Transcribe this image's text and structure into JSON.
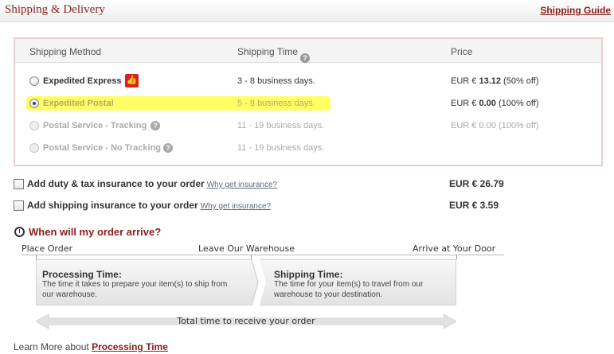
{
  "header": {
    "title": "Shipping & Delivery",
    "guide_link": "Shipping Guide"
  },
  "shipping_table": {
    "columns": [
      "Shipping Method",
      "Shipping Time",
      "Price"
    ],
    "rows": [
      {
        "name": "Expedited Express",
        "time": "3 - 8 business days.",
        "price_prefix": "EUR € ",
        "price_value": "13.12",
        "price_note": " (50% off)",
        "selected": false,
        "disabled": false,
        "badge": "thumbs-up-icon"
      },
      {
        "name": "Expedited Postal",
        "time": "5 - 8 business days.",
        "price_prefix": "EUR € ",
        "price_value": "0.00",
        "price_note": " (100% off)",
        "selected": true,
        "disabled": false,
        "highlight_color": "#ffff66"
      },
      {
        "name": "Postal Service - Tracking",
        "time": "11 - 19 business days.",
        "price_prefix": "EUR € ",
        "price_value": "0.00",
        "price_note": " (100% off)",
        "selected": false,
        "disabled": true
      },
      {
        "name": "Postal Service - No Tracking",
        "time": "11 - 19 business days.",
        "price_prefix": "",
        "price_value": "",
        "price_note": "",
        "selected": false,
        "disabled": true
      }
    ]
  },
  "insurance": [
    {
      "label": "Add duty & tax insurance to your order",
      "why": "Why get insurance?",
      "price": "EUR € 26.79",
      "checked": false
    },
    {
      "label": "Add shipping insurance to your order",
      "why": "Why get insurance?",
      "price": "EUR € 3.59",
      "checked": false
    }
  ],
  "arrival": {
    "title": "When will my order arrive?",
    "milestones": [
      "Place Order",
      "Leave Our Warehouse",
      "Arrive at Your Door"
    ],
    "processing": {
      "title": "Processing Time:",
      "desc": "The time it takes to prepare your item(s) to ship from our warehouse."
    },
    "shipping": {
      "title": "Shipping Time:",
      "desc": "The time  for your item(s) to travel from our warehouse to your destination."
    },
    "total": "Total time to receive your order"
  },
  "learn_more": {
    "prefix": "Learn More about ",
    "link": "Processing Time"
  },
  "colors": {
    "accent": "#8a1e1a",
    "highlight": "#ffff66",
    "badge": "#d9231d"
  }
}
